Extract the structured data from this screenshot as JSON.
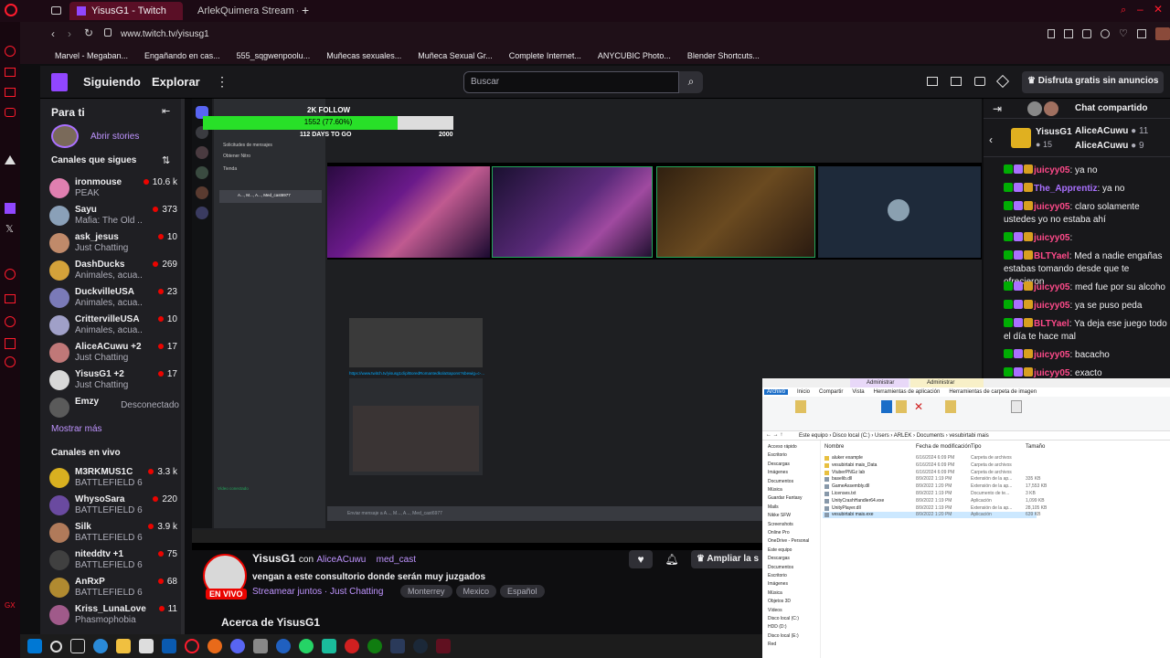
{
  "browser": {
    "tabs": [
      {
        "title": "YisusG1 - Twitch",
        "active": true
      },
      {
        "title": "ArlekQuimera Stream - W",
        "active": false
      }
    ],
    "url": "www.twitch.tv/yisusg1",
    "bookmarks": [
      "Marvel - Megaban...",
      "Engañando en cas...",
      "555_sqgwenpoolu...",
      "Muñecas sexuales...",
      "Muñeca Sexual Gr...",
      "Complete Internet...",
      "ANYCUBIC Photo...",
      "Blender Shortcuts..."
    ]
  },
  "twitch": {
    "nav": {
      "following": "Siguiendo",
      "browse": "Explorar",
      "search_placeholder": "Buscar",
      "turbo": "Disfruta gratis sin anuncios"
    },
    "sidebar": {
      "for_you": "Para ti",
      "open_stories": "Abrir stories",
      "followed_header": "Canales que sigues",
      "followed": [
        {
          "name": "ironmouse",
          "game": "PEAK",
          "viewers": "10.6 k",
          "color": "#e07fb0"
        },
        {
          "name": "Sayu",
          "game": "Mafia: The Old ...",
          "viewers": "373",
          "color": "#8aa0b8"
        },
        {
          "name": "ask_jesus",
          "game": "Just Chatting",
          "viewers": "10",
          "color": "#c08a6a"
        },
        {
          "name": "DashDucks",
          "game": "Animales, acua...",
          "viewers": "269",
          "color": "#d4a23a"
        },
        {
          "name": "DuckvilleUSA",
          "game": "Animales, acua...",
          "viewers": "23",
          "color": "#7a7ab8"
        },
        {
          "name": "CrittervilleUSA",
          "game": "Animales, acua...",
          "viewers": "10",
          "color": "#a0a0c8"
        },
        {
          "name": "AliceACuwu +2",
          "game": "Just Chatting",
          "viewers": "17",
          "color": "#c07878"
        },
        {
          "name": "YisusG1 +2",
          "game": "Just Chatting",
          "viewers": "17",
          "color": "#d8d8d8"
        },
        {
          "name": "Emzy",
          "game": "",
          "viewers": "Desconectado",
          "color": "#5a5a5a"
        }
      ],
      "show_more": "Mostrar más",
      "live_header": "Canales en vivo",
      "live": [
        {
          "name": "M3RKMUS1C",
          "game": "BATTLEFIELD 6",
          "viewers": "3.3 k",
          "color": "#d8b020"
        },
        {
          "name": "WhysoSara",
          "game": "BATTLEFIELD 6",
          "viewers": "220",
          "color": "#6a4aa0"
        },
        {
          "name": "Silk",
          "game": "BATTLEFIELD 6",
          "viewers": "3.9 k",
          "color": "#b07a5a"
        },
        {
          "name": "niteddtv +1",
          "game": "BATTLEFIELD 6",
          "viewers": "75",
          "color": "#404040"
        },
        {
          "name": "AnRxP",
          "game": "BATTLEFIELD 6",
          "viewers": "68",
          "color": "#b08a30"
        },
        {
          "name": "Kriss_LunaLove",
          "game": "Phasmophobia",
          "viewers": "11",
          "color": "#a05a8a"
        }
      ]
    },
    "stream_overlay": {
      "goal_title": "2K FOLLOW",
      "goal_text": "1552 (77.60%)",
      "goal_fraction": 0.776,
      "days": "112 DAYS TO GO",
      "target": "2000"
    },
    "info": {
      "streamer": "YisusG1",
      "with": "con",
      "collab1": "AliceACuwu",
      "collab2": "med_cast",
      "title": "vengan a este consultorio donde serán muy juzgados",
      "live_badge": "EN VIVO",
      "together": "Streamear juntos",
      "category": "Just Chatting",
      "tags": [
        "Monterrey",
        "Mexico",
        "Español"
      ],
      "share_button": "Ampliar la s",
      "about": "Acerca de YisusG1"
    },
    "chat": {
      "header": "Chat compartido",
      "host": "YisusG1",
      "host_viewers": "15",
      "guests": [
        {
          "name": "AliceACuwu",
          "viewers": "11"
        },
        {
          "name": "AliceACuwu",
          "viewers": "9"
        }
      ],
      "messages": [
        {
          "user": "juicyy05",
          "color": "#ff4a8a",
          "text": ": ya no"
        },
        {
          "user": "The_Apprentiz",
          "color": "#a970ff",
          "text": ": ya no"
        },
        {
          "user": "juicyy05",
          "color": "#ff4a8a",
          "text": ": claro solamente ustedes yo no estaba ahí"
        },
        {
          "user": "juicyy05",
          "color": "#ff4a8a",
          "text": ":"
        },
        {
          "user": "BLTYael",
          "color": "#ff4a8a",
          "text": ": Med a nadie engañas estabas tomando desde que te ofrecieron"
        },
        {
          "user": "juicyy05",
          "color": "#ff4a8a",
          "text": ": med fue por su alcoho"
        },
        {
          "user": "juicyy05",
          "color": "#ff4a8a",
          "text": ": ya se puso peda"
        },
        {
          "user": "BLTYael",
          "color": "#ff4a8a",
          "text": ": Ya deja ese juego todo el día te hace mal"
        },
        {
          "user": "juicyy05",
          "color": "#ff4a8a",
          "text": ": bacacho"
        },
        {
          "user": "juicyy05",
          "color": "#ff4a8a",
          "text": ": exacto"
        }
      ]
    }
  },
  "explorer": {
    "ribbon_tabs": [
      "Archivo",
      "Inicio",
      "Compartir",
      "Vista",
      "Herramientas de aplicación",
      "Herramientas de carpeta de imagen"
    ],
    "ribbon_context": [
      "Administrar",
      "Administrar"
    ],
    "breadcrumb": "Este equipo › Disco local (C:) › Users › ARLEK › Documents › vesubirtabi mais",
    "columns": [
      "Nombre",
      "Fecha de modificación",
      "Tipo",
      "Tamaño"
    ],
    "files": [
      {
        "name": "aluker example",
        "date": "6/16/2024 6:09 PM",
        "type": "Carpeta de archivos",
        "size": ""
      },
      {
        "name": "vesubirtabi mais_Data",
        "date": "6/16/2024 6:09 PM",
        "type": "Carpeta de archivos",
        "size": ""
      },
      {
        "name": "VtuberPNGz lab",
        "date": "6/16/2024 6:09 PM",
        "type": "Carpeta de archivos",
        "size": ""
      },
      {
        "name": "baselib.dll",
        "date": "8/9/2022 1:19 PM",
        "type": "Extensión de la ap...",
        "size": "335 KB"
      },
      {
        "name": "GameAssembly.dll",
        "date": "8/9/2022 1:20 PM",
        "type": "Extensión de la ap...",
        "size": "17,553 KB"
      },
      {
        "name": "Licenses.txt",
        "date": "8/9/2022 1:19 PM",
        "type": "Documento de te...",
        "size": "3 KB"
      },
      {
        "name": "UnityCrashHandler64.exe",
        "date": "8/9/2022 1:19 PM",
        "type": "Aplicación",
        "size": "1,099 KB"
      },
      {
        "name": "UnityPlayer.dll",
        "date": "8/9/2022 1:19 PM",
        "type": "Extensión de la ap...",
        "size": "28,105 KB"
      },
      {
        "name": "vesubirtabi mais.exe",
        "date": "8/9/2022 1:20 PM",
        "type": "Aplicación",
        "size": "639 KB"
      }
    ],
    "nav": [
      "Acceso rápido",
      "Escritorio",
      "Descargas",
      "Imágenes",
      "Documentos",
      "Música",
      "Guardar Fantasy",
      "Mails",
      "Nikke SFW",
      "Screenshots",
      "Online Pro",
      "OneDrive - Personal",
      "Este equipo",
      "Descargas",
      "Documentos",
      "Escritorio",
      "Imágenes",
      "Música",
      "Objetos 3D",
      "Vídeos",
      "Disco local (C:)",
      "HDD (D:)",
      "Disco local (E:)",
      "Red"
    ]
  },
  "discord": {
    "dm_header": "Mensajes directos",
    "items": [
      "Amigos",
      "Solicitudes de mensajes",
      "Obtener Nitro",
      "Tienda"
    ],
    "group": "A..., M..., A..., Med_cast6977",
    "link": "https://www.twitch.tv/yisusg1clip/BoredRomantedkolaSapons?sbewig=c-...",
    "message_placeholder": "Enviar mensaje a A..., M..., A..., Med_cast6977",
    "video_status": "Vídeo conectado"
  }
}
